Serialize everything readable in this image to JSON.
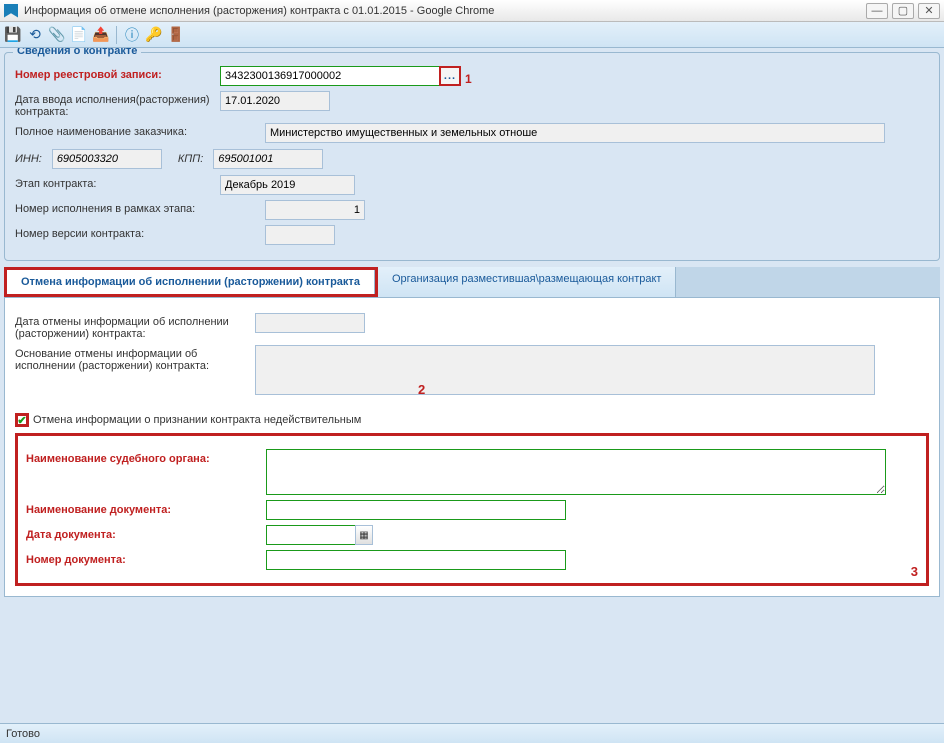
{
  "window": {
    "title": "Информация об отмене исполнения (расторжения) контракта с 01.01.2015 - Google Chrome"
  },
  "toolbar": {
    "icons": {
      "save": "floppy",
      "refresh": "refresh",
      "attach": "clip",
      "doc": "docnew",
      "export": "docarrow",
      "help": "help",
      "key": "key",
      "logout": "logout"
    }
  },
  "contract": {
    "legend": "Сведения о контракте",
    "labels": {
      "registry_no": "Номер реестровой записи:",
      "entry_date": "Дата ввода исполнения(расторжения) контракта:",
      "customer_full": "Полное наименование заказчика:",
      "inn": "ИНН:",
      "kpp": "КПП:",
      "stage": "Этап контракта:",
      "exec_no_in_stage": "Номер исполнения в рамках этапа:",
      "version": "Номер версии контракта:"
    },
    "values": {
      "registry_no": "3432300136917000002",
      "entry_date": "17.01.2020",
      "customer_full": "Министерство имущественных и земельных отноше",
      "inn": "6905003320",
      "kpp": "695001001",
      "stage": "Декабрь 2019",
      "exec_no_in_stage": "1",
      "version": ""
    }
  },
  "tabs": {
    "tab1": "Отмена информации об исполнении (расторжении) контракта",
    "tab2": "Организация разместившая\\размещающая контракт"
  },
  "cancel": {
    "labels": {
      "cancel_date": "Дата отмены информации об исполнении (расторжении) контракта:",
      "cancel_basis": "Основание отмены информации об исполнении (расторжении) контракта:",
      "cancel_invalidation": "Отмена информации о признании контракта недействительным",
      "court_name": "Наименование судебного органа:",
      "doc_name": "Наименование документа:",
      "doc_date": "Дата документа:",
      "doc_no": "Номер документа:"
    },
    "values": {
      "cancel_date": "",
      "cancel_basis": "",
      "cancel_invalidation_checked": true,
      "court_name": "",
      "doc_name": "",
      "doc_date": "",
      "doc_no": ""
    }
  },
  "status": {
    "text": "Готово"
  },
  "annotations": {
    "a1": "1",
    "a2": "2",
    "a3": "3"
  }
}
